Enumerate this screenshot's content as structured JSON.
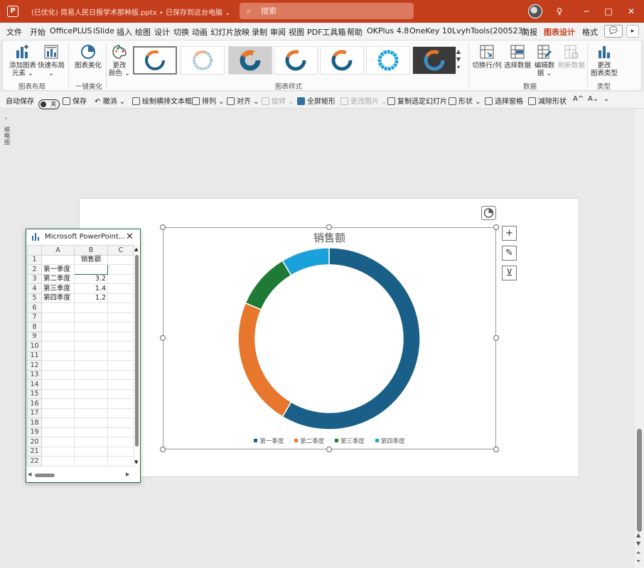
{
  "titlebar": {
    "app_icon": "P",
    "doc_title": "(已优化) 简易人民日报学术那种版.pptx • 已保存到这台电脑 ⌄",
    "search_placeholder": "搜索",
    "minimize": "─",
    "maximize": "□",
    "close": "✕",
    "lightbulb": "♀"
  },
  "menu": {
    "tabs": [
      "文件",
      "开始",
      "OfficePLUS",
      "iSlide",
      "插入",
      "绘图",
      "设计",
      "切换",
      "动画",
      "幻灯片放映",
      "录制",
      "审阅",
      "视图",
      "PDF工具箱",
      "帮助",
      "OKPlus 4.8",
      "OneKey 10",
      "LvyhTools(200523)",
      "简报",
      "图表设计",
      "格式"
    ],
    "active_tab": "图表设计",
    "comment_btn": "💬",
    "more_btn": "▸"
  },
  "ribbon": {
    "groups": [
      {
        "label": "图表布局",
        "buttons": [
          "添加图表元素",
          "快速布局"
        ]
      },
      {
        "label": "一键美化",
        "buttons": [
          "图表美化"
        ]
      },
      {
        "label": "图表样式",
        "buttons": [
          "更改颜色"
        ]
      },
      {
        "label": "数据",
        "buttons": [
          "切换行/列",
          "选择数据",
          "编辑数据",
          "刷新数据"
        ]
      },
      {
        "label": "类型",
        "buttons": [
          "更改图表类型"
        ]
      }
    ],
    "add_element": [
      "添加图表",
      "元素 ⌄"
    ],
    "quick_layout": [
      "快速布局",
      "⌄"
    ],
    "beautify": "图表美化",
    "change_color": [
      "更改",
      "颜色 ⌄"
    ],
    "switch": "切换行/列",
    "select": "选择数据",
    "edit": [
      "编辑数",
      "据 ⌄"
    ],
    "refresh": "刷新数据",
    "change_type": [
      "更改",
      "图表类型"
    ]
  },
  "qat": {
    "autosave_label": "自动保存",
    "autosave_state": "关",
    "items": [
      "保存",
      "撤消 ⌄",
      "绘制横排文本框",
      "排列 ⌄",
      "对齐 ⌄",
      "旋转 ⌄",
      "全屏矩形",
      "更改图片 ⌄",
      "复制选定幻灯片",
      "形状 ⌄",
      "选择窗格",
      "减除形状",
      "A^",
      "A⌄",
      "⌄"
    ]
  },
  "left_pane": {
    "label": "缩略图"
  },
  "chart": {
    "title": "销售额",
    "legend": [
      "第一季度",
      "第二季度",
      "第三季度",
      "第四季度"
    ],
    "side_buttons": [
      "+",
      "✎",
      "⊻"
    ]
  },
  "chart_data": {
    "type": "pie",
    "title": "销售额",
    "categories": [
      "第一季度",
      "第二季度",
      "第三季度",
      "第四季度"
    ],
    "values": [
      8.2,
      3.2,
      1.4,
      1.2
    ],
    "colors": [
      "#1a5f87",
      "#e8772e",
      "#1e7a34",
      "#1aa1d9"
    ],
    "donut": true,
    "legend_position": "bottom"
  },
  "spreadsheet": {
    "title": "Microsoft PowerPoint...",
    "close": "✕",
    "columns": [
      "A",
      "B",
      "C"
    ],
    "header_row": [
      "",
      "销售额",
      ""
    ],
    "rows": [
      [
        "第一季度",
        "",
        ""
      ],
      [
        "第二季度",
        "3.2",
        ""
      ],
      [
        "第三季度",
        "1.4",
        ""
      ],
      [
        "第四季度",
        "1.2",
        ""
      ]
    ],
    "row_numbers": [
      "1",
      "2",
      "3",
      "4",
      "5",
      "6",
      "7",
      "8",
      "9",
      "10",
      "11",
      "12",
      "13",
      "14",
      "15",
      "16",
      "17",
      "18",
      "19",
      "20",
      "21",
      "22"
    ]
  },
  "colors": {
    "accent": "#c43e1c",
    "excel_green": "#217346"
  }
}
